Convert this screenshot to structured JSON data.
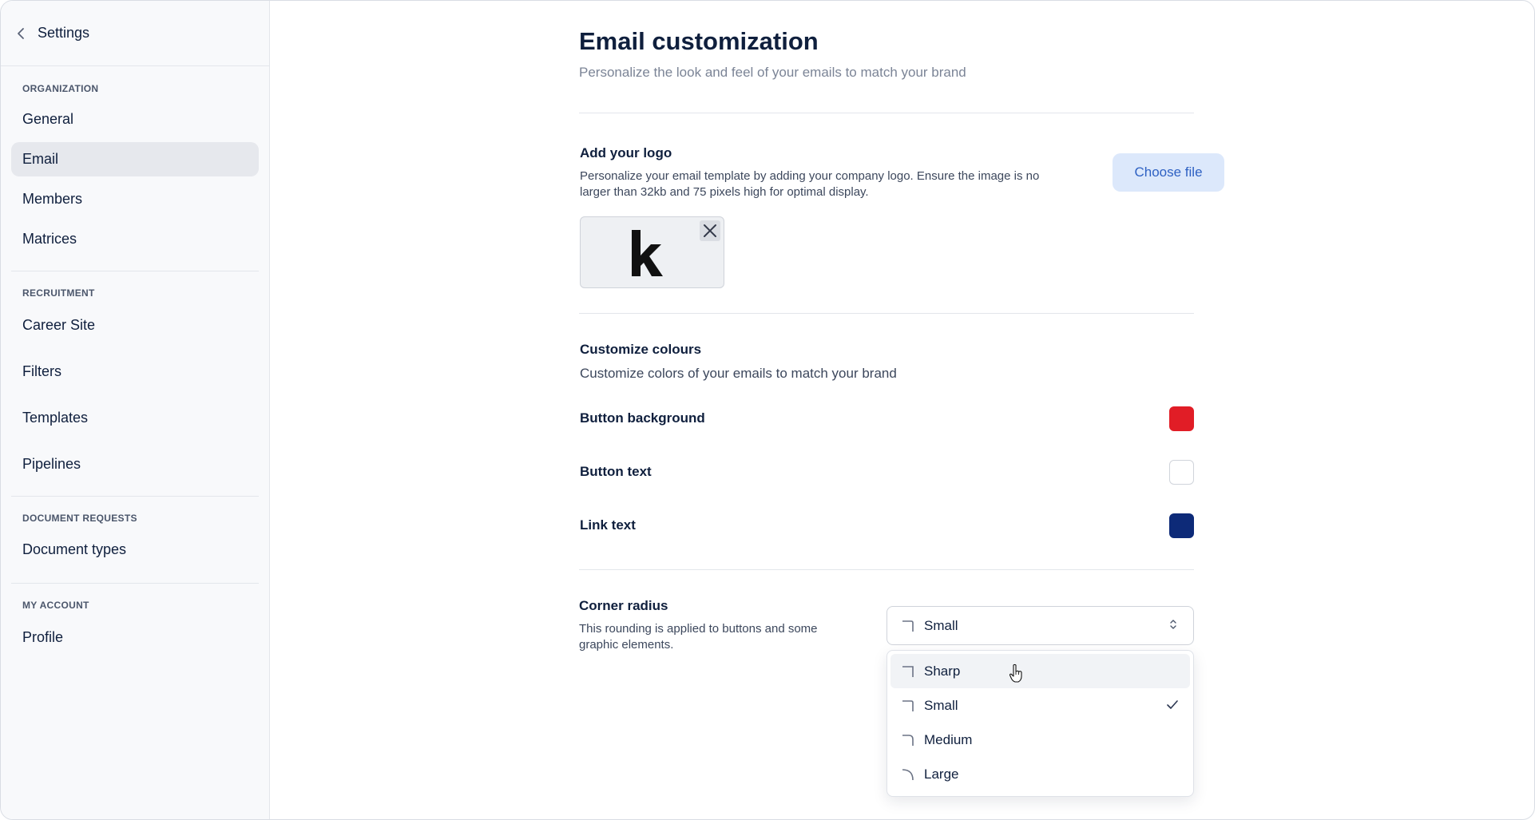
{
  "sidebar": {
    "title": "Settings",
    "sections": [
      {
        "label": "ORGANIZATION",
        "items": [
          "General",
          "Email",
          "Members",
          "Matrices"
        ]
      },
      {
        "label": "RECRUITMENT",
        "items": [
          "Career Site",
          "Filters",
          "Templates",
          "Pipelines"
        ]
      },
      {
        "label": "DOCUMENT REQUESTS",
        "items": [
          "Document types"
        ]
      },
      {
        "label": "MY ACCOUNT",
        "items": [
          "Profile"
        ]
      }
    ],
    "active_item": "Email"
  },
  "page": {
    "title": "Email customization",
    "subtitle": "Personalize the look and feel of your emails to match your brand"
  },
  "logo": {
    "title": "Add your logo",
    "description": "Personalize your email template by adding your company logo. Ensure the image is no larger than 32kb and 75 pixels high for optimal display.",
    "button_label": "Choose file",
    "logo_letter": "k"
  },
  "colours": {
    "title": "Customize colours",
    "description": "Customize colors of your emails to match your brand",
    "rows": [
      {
        "label": "Button background",
        "color": "#e11d26"
      },
      {
        "label": "Button text",
        "color": "#ffffff"
      },
      {
        "label": "Link text",
        "color": "#0d2a78"
      }
    ]
  },
  "corner_radius": {
    "title": "Corner radius",
    "description": "This rounding is applied to buttons and some graphic elements.",
    "selected": "Small",
    "options": [
      "Sharp",
      "Small",
      "Medium",
      "Large"
    ],
    "hovered": "Sharp"
  }
}
